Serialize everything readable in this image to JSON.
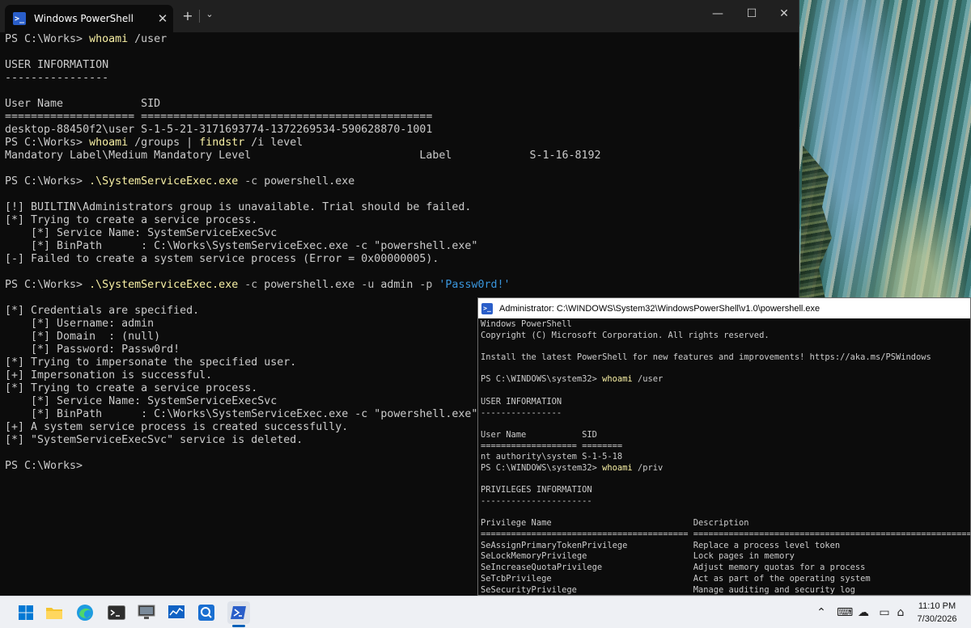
{
  "main_window": {
    "tab_title": "Windows PowerShell",
    "tab_icon_glyph": ">_",
    "tab_close": "✕",
    "new_tab": "+",
    "dropdown": "⌄",
    "minimize": "—",
    "maximize": "☐",
    "close": "✕"
  },
  "main_console": [
    [
      {
        "t": "PS C:\\Works> "
      },
      {
        "t": "whoami",
        "c": "yellow"
      },
      {
        "t": " /user"
      }
    ],
    [
      {
        "t": ""
      }
    ],
    [
      {
        "t": "USER INFORMATION"
      }
    ],
    [
      {
        "t": "----------------"
      }
    ],
    [
      {
        "t": ""
      }
    ],
    [
      {
        "t": "User Name            SID"
      }
    ],
    [
      {
        "t": "==================== ============================================="
      }
    ],
    [
      {
        "t": "desktop-88450f2\\user S-1-5-21-3171693774-1372269534-590628870-1001"
      }
    ],
    [
      {
        "t": "PS C:\\Works> "
      },
      {
        "t": "whoami",
        "c": "yellow"
      },
      {
        "t": " /groups | "
      },
      {
        "t": "findstr",
        "c": "yellow"
      },
      {
        "t": " /i level"
      }
    ],
    [
      {
        "t": "Mandatory Label\\Medium Mandatory Level                          Label            S-1-16-8192"
      }
    ],
    [
      {
        "t": ""
      }
    ],
    [
      {
        "t": "PS C:\\Works> "
      },
      {
        "t": ".\\SystemServiceExec.exe",
        "c": "yellow"
      },
      {
        "t": " -c",
        "c": "gray"
      },
      {
        "t": " powershell.exe"
      }
    ],
    [
      {
        "t": ""
      }
    ],
    [
      {
        "t": "[!] BUILTIN\\Administrators group is unavailable. Trial should be failed."
      }
    ],
    [
      {
        "t": "[*] Trying to create a service process."
      }
    ],
    [
      {
        "t": "    [*] Service Name: SystemServiceExecSvc"
      }
    ],
    [
      {
        "t": "    [*] BinPath      : C:\\Works\\SystemServiceExec.exe -c \"powershell.exe\""
      }
    ],
    [
      {
        "t": "[-] Failed to create a system service process (Error = 0x00000005)."
      }
    ],
    [
      {
        "t": ""
      }
    ],
    [
      {
        "t": "PS C:\\Works> "
      },
      {
        "t": ".\\SystemServiceExec.exe",
        "c": "yellow"
      },
      {
        "t": " -c",
        "c": "gray"
      },
      {
        "t": " powershell.exe "
      },
      {
        "t": "-u",
        "c": "gray"
      },
      {
        "t": " admin "
      },
      {
        "t": "-p",
        "c": "gray"
      },
      {
        "t": " "
      },
      {
        "t": "'Passw0rd!'",
        "c": "cyan"
      }
    ],
    [
      {
        "t": ""
      }
    ],
    [
      {
        "t": "[*] Credentials are specified."
      }
    ],
    [
      {
        "t": "    [*] Username: admin"
      }
    ],
    [
      {
        "t": "    [*] Domain  : (null)"
      }
    ],
    [
      {
        "t": "    [*] Password: Passw0rd!"
      }
    ],
    [
      {
        "t": "[*] Trying to impersonate the specified user."
      }
    ],
    [
      {
        "t": "[+] Impersonation is successful."
      }
    ],
    [
      {
        "t": "[*] Trying to create a service process."
      }
    ],
    [
      {
        "t": "    [*] Service Name: SystemServiceExecSvc"
      }
    ],
    [
      {
        "t": "    [*] BinPath      : C:\\Works\\SystemServiceExec.exe -c \"powershell.exe\""
      }
    ],
    [
      {
        "t": "[+] A system service process is created successfully."
      }
    ],
    [
      {
        "t": "[*] \"SystemServiceExecSvc\" service is deleted."
      }
    ],
    [
      {
        "t": ""
      }
    ],
    [
      {
        "t": "PS C:\\Works> "
      }
    ]
  ],
  "admin_window": {
    "title": "Administrator: C:\\WINDOWS\\System32\\WindowsPowerShell\\v1.0\\powershell.exe",
    "icon_glyph": ">_"
  },
  "admin_console": [
    [
      {
        "t": "Windows PowerShell"
      }
    ],
    [
      {
        "t": "Copyright (C) Microsoft Corporation. All rights reserved."
      }
    ],
    [
      {
        "t": ""
      }
    ],
    [
      {
        "t": "Install the latest PowerShell for new features and improvements! https://aka.ms/PSWindows"
      }
    ],
    [
      {
        "t": ""
      }
    ],
    [
      {
        "t": "PS C:\\WINDOWS\\system32> "
      },
      {
        "t": "whoami",
        "c": "yellow"
      },
      {
        "t": " /user"
      }
    ],
    [
      {
        "t": ""
      }
    ],
    [
      {
        "t": "USER INFORMATION"
      }
    ],
    [
      {
        "t": "----------------"
      }
    ],
    [
      {
        "t": ""
      }
    ],
    [
      {
        "t": "User Name           SID"
      }
    ],
    [
      {
        "t": "=================== ========"
      }
    ],
    [
      {
        "t": "nt authority\\system S-1-5-18"
      }
    ],
    [
      {
        "t": "PS C:\\WINDOWS\\system32> "
      },
      {
        "t": "whoami",
        "c": "yellow"
      },
      {
        "t": " /priv"
      }
    ],
    [
      {
        "t": ""
      }
    ],
    [
      {
        "t": "PRIVILEGES INFORMATION"
      }
    ],
    [
      {
        "t": "----------------------"
      }
    ],
    [
      {
        "t": ""
      }
    ],
    [
      {
        "t": "Privilege Name                            Description"
      }
    ],
    [
      {
        "t": "========================================= =================================================================="
      }
    ],
    [
      {
        "t": "SeAssignPrimaryTokenPrivilege             Replace a process level token"
      }
    ],
    [
      {
        "t": "SeLockMemoryPrivilege                     Lock pages in memory"
      }
    ],
    [
      {
        "t": "SeIncreaseQuotaPrivilege                  Adjust memory quotas for a process"
      }
    ],
    [
      {
        "t": "SeTcbPrivilege                            Act as part of the operating system"
      }
    ],
    [
      {
        "t": "SeSecurityPrivilege                       Manage auditing and security log"
      }
    ]
  ],
  "taskbar": {
    "apps": [
      {
        "name": "start-button",
        "icon": "windows-logo-icon"
      },
      {
        "name": "file-explorer",
        "icon": "folder-icon"
      },
      {
        "name": "edge",
        "icon": "edge-icon"
      },
      {
        "name": "terminal",
        "icon": "terminal-icon"
      },
      {
        "name": "remote-desktop",
        "icon": "remote-desktop-icon"
      },
      {
        "name": "performance-monitor",
        "icon": "chart-icon"
      },
      {
        "name": "search-app",
        "icon": "magnifier-icon"
      },
      {
        "name": "powershell",
        "icon": "powershell-icon"
      }
    ],
    "time": "11:10 PM",
    "date": "7/30/2026"
  },
  "colors": {
    "console_bg": "#0c0c0c",
    "console_text": "#cccccc",
    "command_yellow": "#f9f1a5",
    "string_cyan": "#3a96dd",
    "taskbar_bg": "#eef0f4",
    "accent": "#005fb8"
  }
}
